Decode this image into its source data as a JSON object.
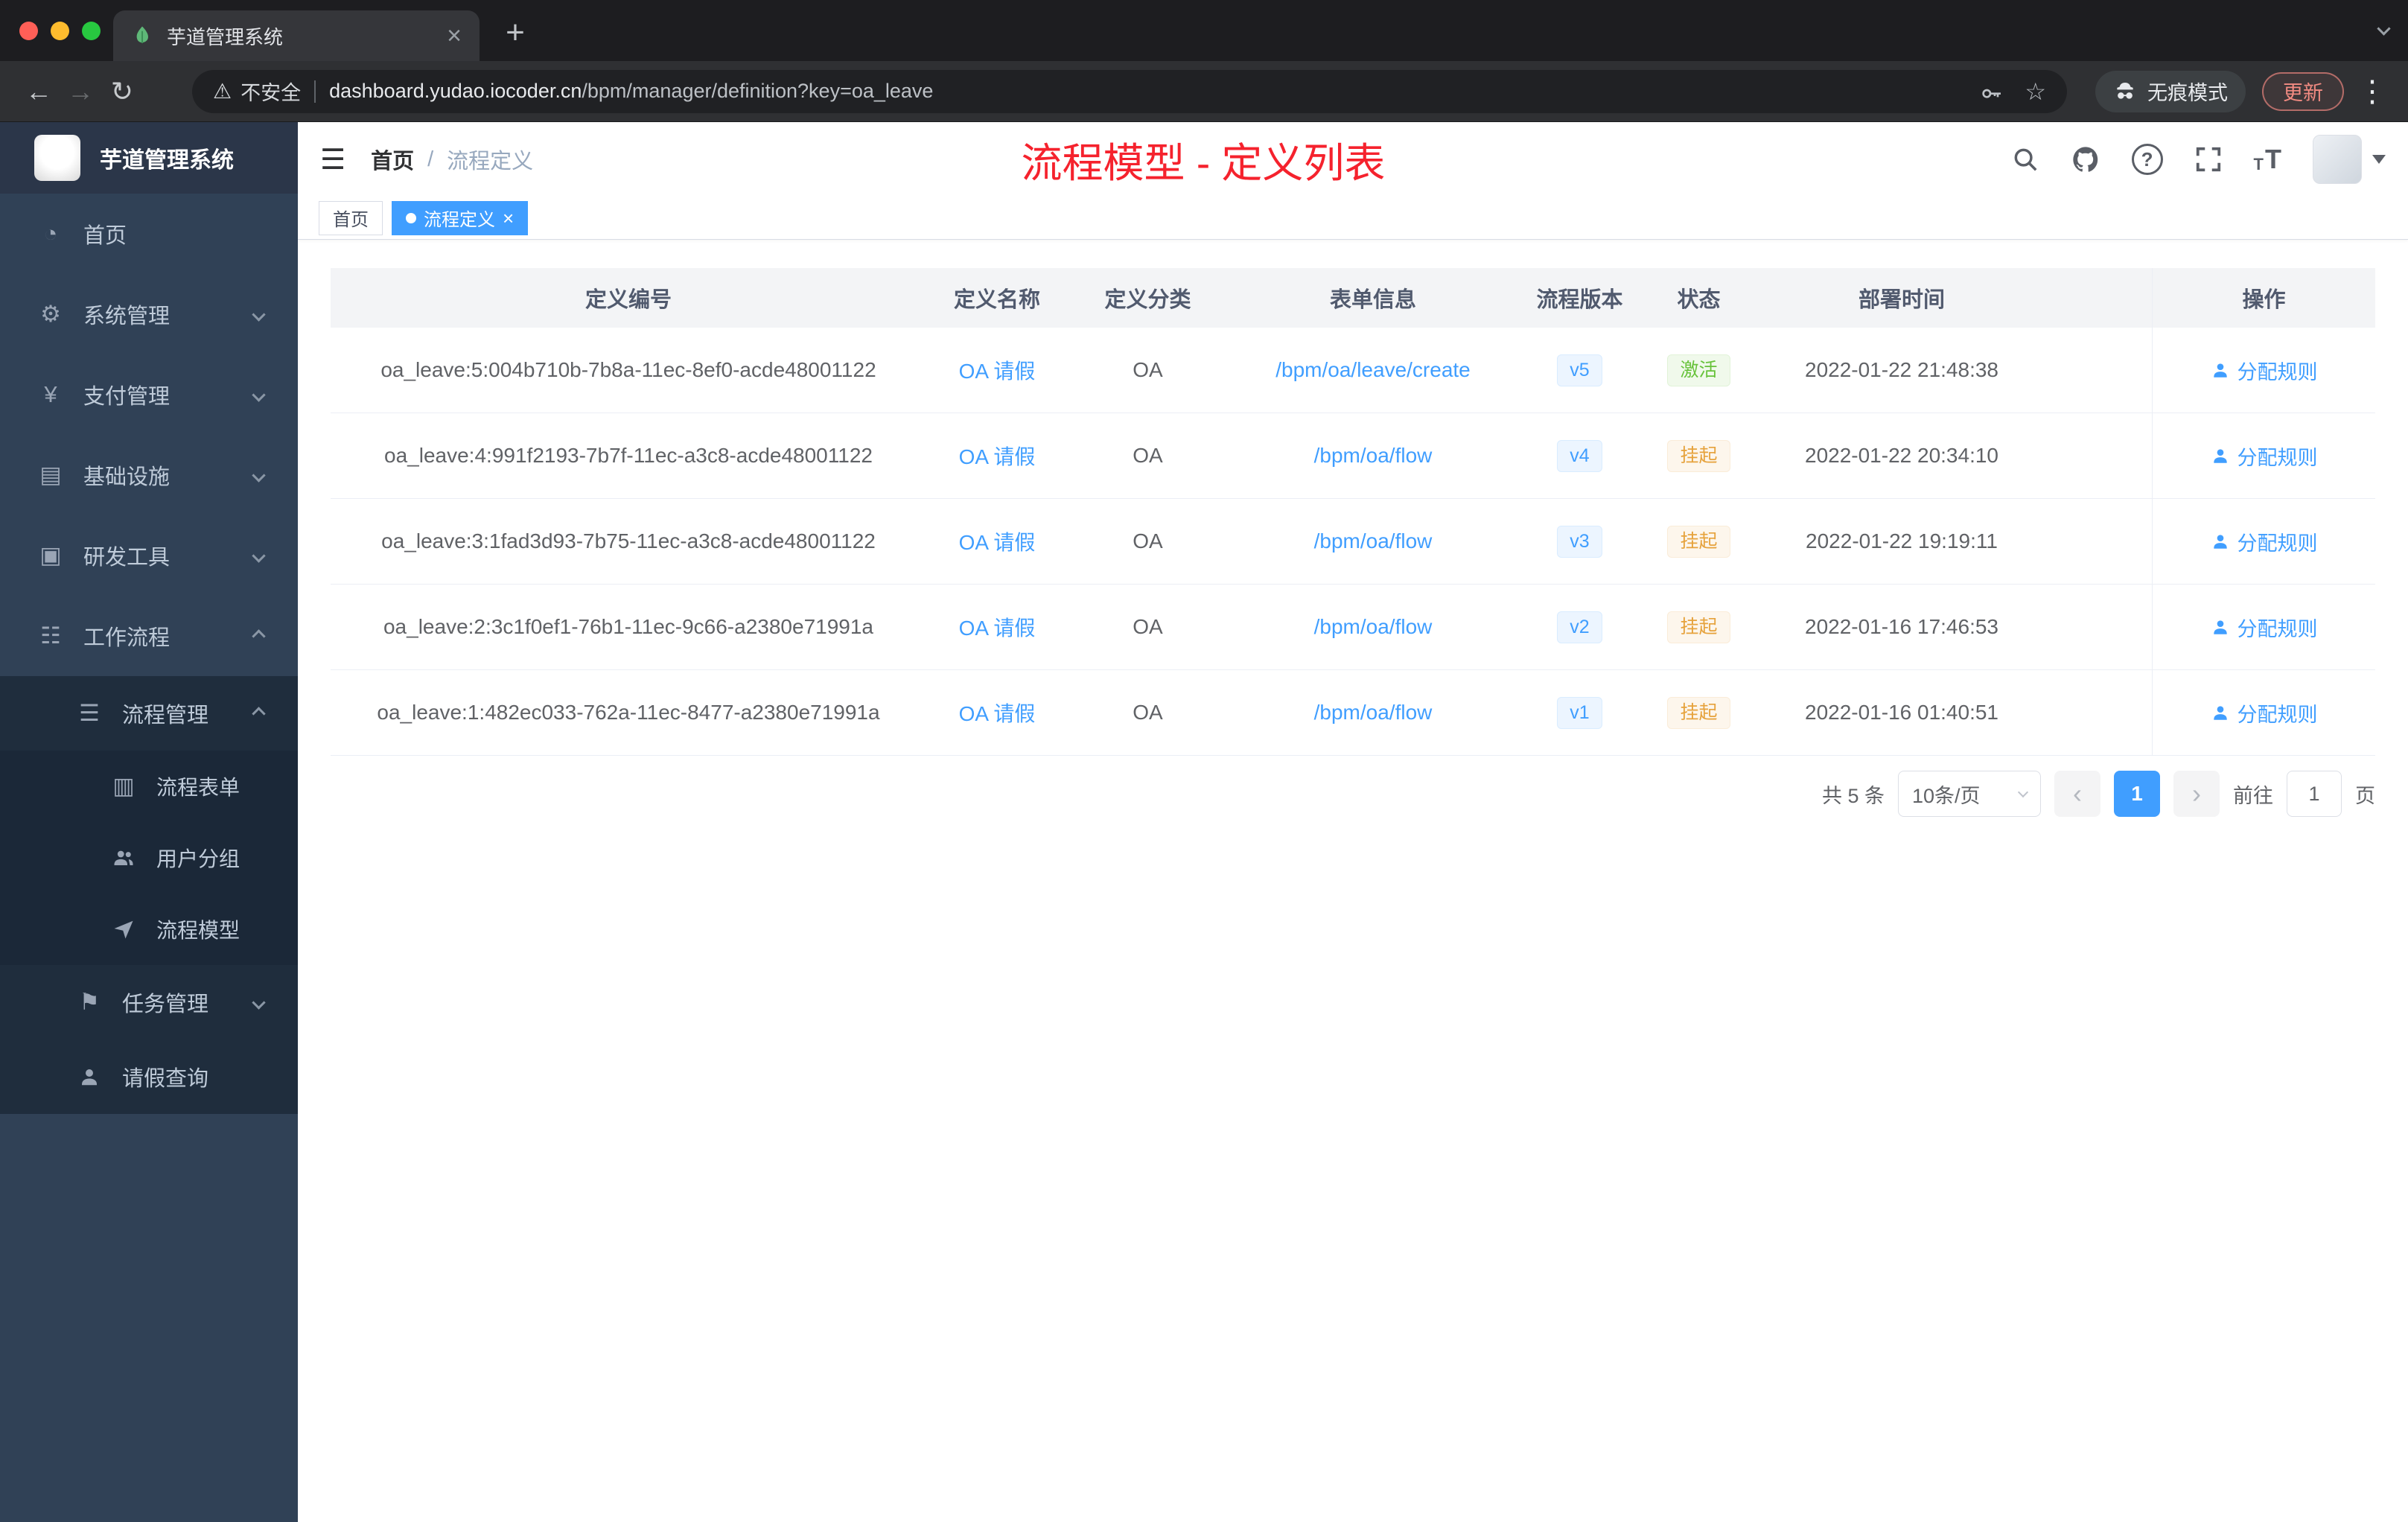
{
  "colors": {
    "accent": "#409eff",
    "success": "#67c23a",
    "warning": "#e6a23c",
    "annotation": "#f5222d",
    "sidebar-bg": "#304156",
    "sidebar-sub-bg": "#1f2d3d",
    "sidebar-sub2-bg": "#1b2838",
    "chrome-strip": "#1d1d20",
    "chrome-toolbar": "#2f3033",
    "omnibox": "#202124",
    "mac-red": "#ff5f57",
    "mac-yellow": "#febc2e",
    "mac-green": "#28c840"
  },
  "icons": {
    "dashboard": "◔",
    "settings": "⚙",
    "payment": "¥",
    "infra": "▤",
    "devtools": "▣",
    "workflow": "☷",
    "process": "☰",
    "form": "▥",
    "flag": "⚑",
    "back": "←",
    "forward": "→",
    "reload": "↻",
    "warning": "⚠",
    "star": "☆",
    "dots": "⋮",
    "close": "×",
    "plus": "+",
    "prev": "‹",
    "next": "›",
    "question": "?",
    "hamburger": "☰",
    "text_small": "T",
    "text_large": "T"
  },
  "browser": {
    "tab_title": "芋道管理系统",
    "security_label": "不安全",
    "url_domain": "dashboard.yudao.iocoder.cn",
    "url_path": "/bpm/manager/definition?key=oa_leave",
    "incognito_label": "无痕模式",
    "update_label": "更新"
  },
  "sidebar": {
    "logo_title": "芋道管理系统",
    "items": [
      {
        "label": "首页"
      },
      {
        "label": "系统管理"
      },
      {
        "label": "支付管理"
      },
      {
        "label": "基础设施"
      },
      {
        "label": "研发工具"
      },
      {
        "label": "工作流程"
      },
      {
        "label": "流程管理"
      },
      {
        "label": "流程表单"
      },
      {
        "label": "用户分组"
      },
      {
        "label": "流程模型"
      },
      {
        "label": "任务管理"
      },
      {
        "label": "请假查询"
      }
    ]
  },
  "header": {
    "breadcrumb_home": "首页",
    "breadcrumb_separator": "/",
    "breadcrumb_current": "流程定义",
    "annotation": "流程模型 - 定义列表"
  },
  "tags": {
    "home": "首页",
    "active": "流程定义"
  },
  "table": {
    "columns": [
      "定义编号",
      "定义名称",
      "定义分类",
      "表单信息",
      "流程版本",
      "状态",
      "部署时间",
      "操作"
    ],
    "action_label": "分配规则",
    "rows": [
      {
        "id": "oa_leave:5:004b710b-7b8a-11ec-8ef0-acde48001122",
        "name": "OA 请假",
        "category": "OA",
        "form": "/bpm/oa/leave/create",
        "version": "v5",
        "status": "激活",
        "status_type": "success",
        "time": "2022-01-22 21:48:38"
      },
      {
        "id": "oa_leave:4:991f2193-7b7f-11ec-a3c8-acde48001122",
        "name": "OA 请假",
        "category": "OA",
        "form": "/bpm/oa/flow",
        "version": "v4",
        "status": "挂起",
        "status_type": "warning",
        "time": "2022-01-22 20:34:10"
      },
      {
        "id": "oa_leave:3:1fad3d93-7b75-11ec-a3c8-acde48001122",
        "name": "OA 请假",
        "category": "OA",
        "form": "/bpm/oa/flow",
        "version": "v3",
        "status": "挂起",
        "status_type": "warning",
        "time": "2022-01-22 19:19:11"
      },
      {
        "id": "oa_leave:2:3c1f0ef1-76b1-11ec-9c66-a2380e71991a",
        "name": "OA 请假",
        "category": "OA",
        "form": "/bpm/oa/flow",
        "version": "v2",
        "status": "挂起",
        "status_type": "warning",
        "time": "2022-01-16 17:46:53"
      },
      {
        "id": "oa_leave:1:482ec033-762a-11ec-8477-a2380e71991a",
        "name": "OA 请假",
        "category": "OA",
        "form": "/bpm/oa/flow",
        "version": "v1",
        "status": "挂起",
        "status_type": "warning",
        "time": "2022-01-16 01:40:51"
      }
    ]
  },
  "pagination": {
    "total": "共 5 条",
    "page_size": "10条/页",
    "page": "1",
    "goto_label": "前往",
    "goto_value": "1",
    "goto_unit": "页"
  }
}
